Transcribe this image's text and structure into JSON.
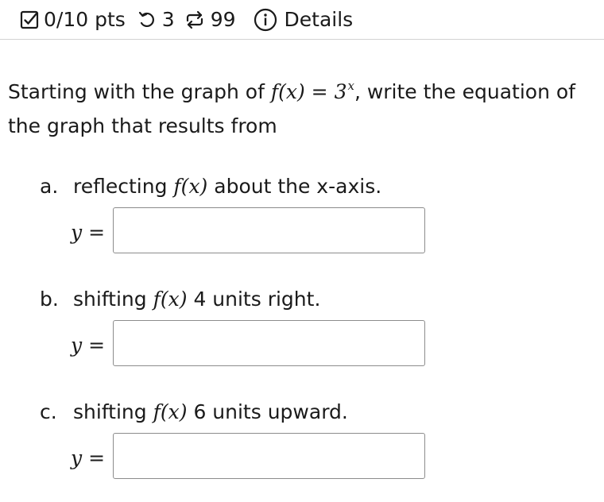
{
  "header": {
    "points": "0/10 pts",
    "retries": "3",
    "submissions": "99",
    "details_label": "Details"
  },
  "question": {
    "prompt_before": "Starting with the graph of ",
    "prompt_fn": "f",
    "prompt_paren_open": "(",
    "prompt_var": "x",
    "prompt_paren_close": ")",
    "prompt_eq": " = ",
    "prompt_base": "3",
    "prompt_exp": "x",
    "prompt_after": ", write the equation of the graph that results from"
  },
  "parts": [
    {
      "letter": "a.",
      "text_before": "reflecting ",
      "fn": "f",
      "var": "x",
      "text_after": " about the x-axis.",
      "answer_label": "y =",
      "answer_value": ""
    },
    {
      "letter": "b.",
      "text_before": "shifting ",
      "fn": "f",
      "var": "x",
      "text_after": " 4 units right.",
      "answer_label": "y =",
      "answer_value": ""
    },
    {
      "letter": "c.",
      "text_before": "shifting ",
      "fn": "f",
      "var": "x",
      "text_after": " 6 units upward.",
      "answer_label": "y =",
      "answer_value": ""
    }
  ]
}
